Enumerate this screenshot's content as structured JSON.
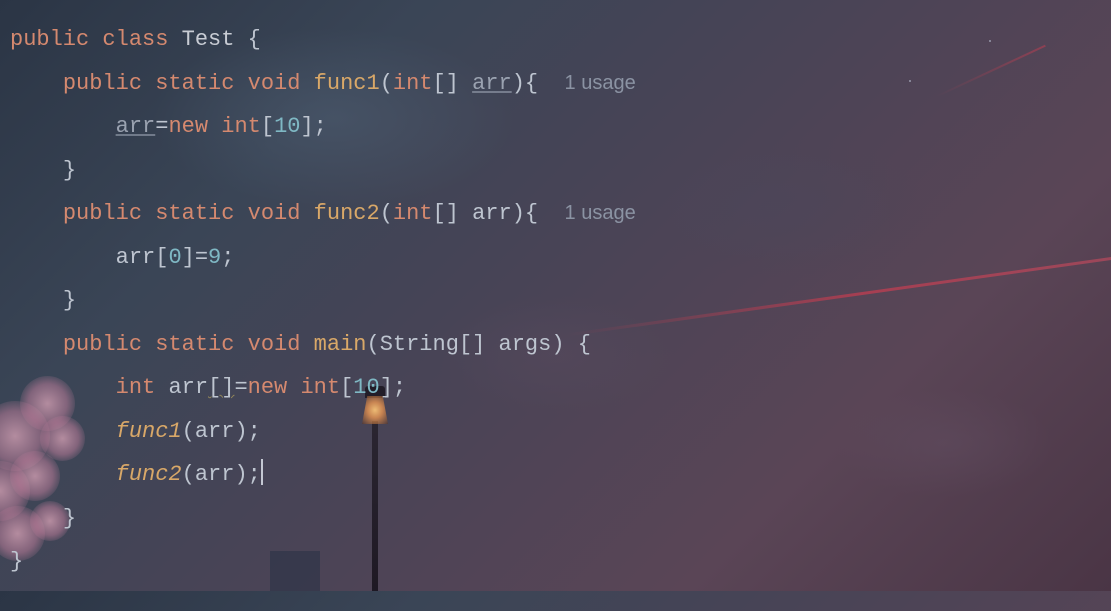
{
  "code": {
    "line1": {
      "kw_public": "public",
      "kw_class": "class",
      "classname": "Test",
      "brace": " {"
    },
    "line2": {
      "indent": "    ",
      "kw_public": "public",
      "kw_static": "static",
      "kw_void": "void",
      "method": "func1",
      "lparen": "(",
      "type_int": "int",
      "brackets": "[] ",
      "param": "arr",
      "rparen_brace": "){",
      "hint_sep": "  ",
      "hint": "1 usage"
    },
    "line3": {
      "indent": "        ",
      "param": "arr",
      "eq": "=",
      "kw_new": "new",
      "sp": " ",
      "type_int": "int",
      "lbrack": "[",
      "num": "10",
      "rbrack_semi": "];"
    },
    "line4": {
      "indent": "    ",
      "brace": "}"
    },
    "line5": {
      "indent": "    ",
      "kw_public": "public",
      "kw_static": "static",
      "kw_void": "void",
      "method": "func2",
      "lparen": "(",
      "type_int": "int",
      "brackets": "[] ",
      "param": "arr",
      "rparen_brace": "){",
      "hint_sep": "  ",
      "hint": "1 usage"
    },
    "line6": {
      "indent": "        ",
      "ident": "arr",
      "lbrack": "[",
      "num0": "0",
      "rbrack": "]",
      "eq": "=",
      "num9": "9",
      "semi": ";"
    },
    "line7": {
      "indent": "    ",
      "brace": "}"
    },
    "line8": {
      "indent": "    ",
      "kw_public": "public",
      "kw_static": "static",
      "kw_void": "void",
      "method": "main",
      "lparen": "(",
      "type_string": "String",
      "brackets": "[] ",
      "param": "args",
      "rparen_brace": ") {"
    },
    "line9": {
      "indent": "        ",
      "type_int": "int",
      "sp": " ",
      "ident": "arr",
      "brackets": "[]",
      "eq": "=",
      "kw_new": "new",
      "sp2": " ",
      "type_int2": "int",
      "lbrack": "[",
      "num": "10",
      "rbrack_semi": "];"
    },
    "line10": {
      "indent": "        ",
      "method": "func1",
      "lparen": "(",
      "ident": "arr",
      "rparen_semi": ");"
    },
    "line11": {
      "indent": "        ",
      "method": "func2",
      "lparen": "(",
      "ident": "arr",
      "rparen_semi": ");"
    },
    "line12": {
      "indent": "    ",
      "brace": "}"
    },
    "line13": {
      "brace": "}"
    }
  }
}
